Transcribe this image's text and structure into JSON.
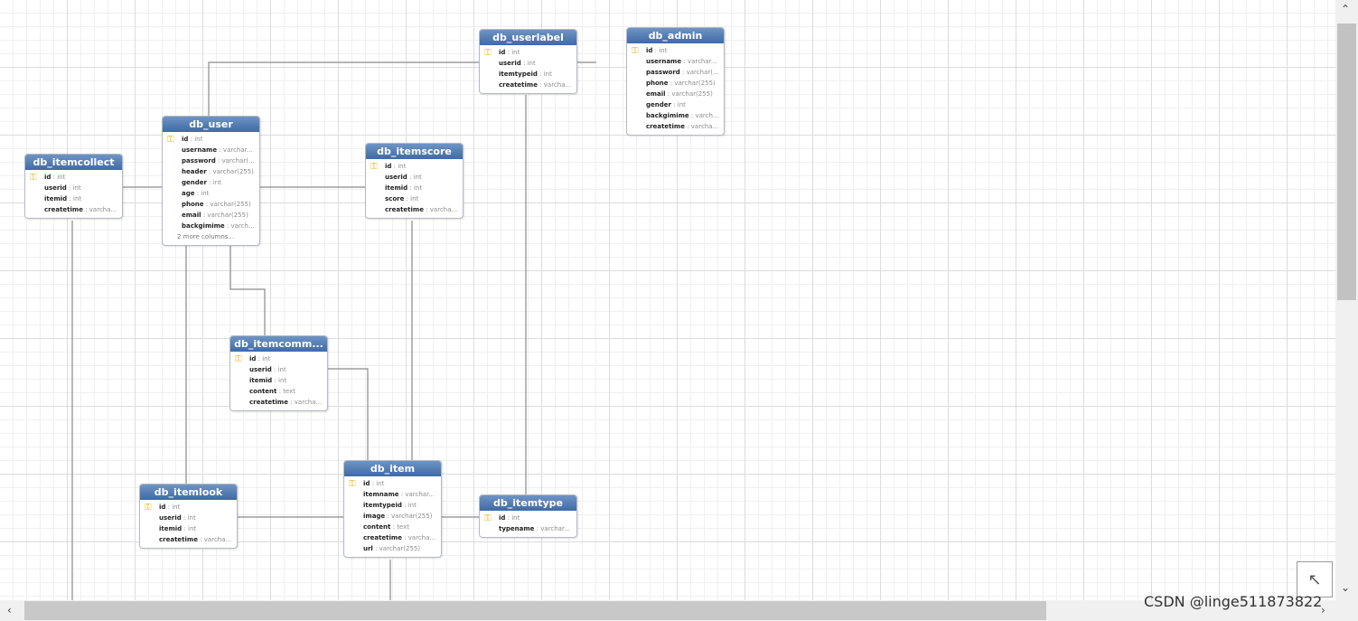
{
  "tables": [
    {
      "id": "db_userlabel",
      "title": "db_userlabel",
      "columns": [
        {
          "name": "id",
          "type": "int",
          "pk": true
        },
        {
          "name": "userid",
          "type": "int"
        },
        {
          "name": "itemtypeid",
          "type": "int"
        },
        {
          "name": "createtime",
          "type": "varcha..."
        }
      ]
    },
    {
      "id": "db_admin",
      "title": "db_admin",
      "columns": [
        {
          "name": "id",
          "type": "int",
          "pk": true
        },
        {
          "name": "username",
          "type": "varchar..."
        },
        {
          "name": "password",
          "type": "varchar(..."
        },
        {
          "name": "phone",
          "type": "varchar(255)"
        },
        {
          "name": "email",
          "type": "varchar(255)"
        },
        {
          "name": "gender",
          "type": "int"
        },
        {
          "name": "backgimime",
          "type": "varch..."
        },
        {
          "name": "createtime",
          "type": "varcha..."
        }
      ]
    },
    {
      "id": "db_user",
      "title": "db_user",
      "more": "2 more columns...",
      "columns": [
        {
          "name": "id",
          "type": "int",
          "pk": true
        },
        {
          "name": "username",
          "type": "varchar..."
        },
        {
          "name": "password",
          "type": "varchar(..."
        },
        {
          "name": "header",
          "type": "varchar(255)"
        },
        {
          "name": "gender",
          "type": "int"
        },
        {
          "name": "age",
          "type": "int"
        },
        {
          "name": "phone",
          "type": "varchar(255)"
        },
        {
          "name": "email",
          "type": "varchar(255)"
        },
        {
          "name": "backgimime",
          "type": "varch..."
        }
      ]
    },
    {
      "id": "db_itemcollect",
      "title": "db_itemcollect",
      "columns": [
        {
          "name": "id",
          "type": "int",
          "pk": true
        },
        {
          "name": "userid",
          "type": "int"
        },
        {
          "name": "itemid",
          "type": "int"
        },
        {
          "name": "createtime",
          "type": "varcha..."
        }
      ]
    },
    {
      "id": "db_itemscore",
      "title": "db_itemscore",
      "columns": [
        {
          "name": "id",
          "type": "int",
          "pk": true
        },
        {
          "name": "userid",
          "type": "int"
        },
        {
          "name": "itemid",
          "type": "int"
        },
        {
          "name": "score",
          "type": "int"
        },
        {
          "name": "createtime",
          "type": "varcha..."
        }
      ]
    },
    {
      "id": "db_itemcomment",
      "title": "db_itemcomm...",
      "columns": [
        {
          "name": "id",
          "type": "int",
          "pk": true
        },
        {
          "name": "userid",
          "type": "int"
        },
        {
          "name": "itemid",
          "type": "int"
        },
        {
          "name": "content",
          "type": "text"
        },
        {
          "name": "createtime",
          "type": "varcha..."
        }
      ]
    },
    {
      "id": "db_item",
      "title": "db_item",
      "columns": [
        {
          "name": "id",
          "type": "int",
          "pk": true
        },
        {
          "name": "itemname",
          "type": "varchar..."
        },
        {
          "name": "itemtypeid",
          "type": "int"
        },
        {
          "name": "image",
          "type": "varchar(255)"
        },
        {
          "name": "content",
          "type": "text"
        },
        {
          "name": "createtime",
          "type": "varcha..."
        },
        {
          "name": "url",
          "type": "varchar(255)"
        }
      ]
    },
    {
      "id": "db_itemlook",
      "title": "db_itemlook",
      "columns": [
        {
          "name": "id",
          "type": "int",
          "pk": true
        },
        {
          "name": "userid",
          "type": "int"
        },
        {
          "name": "itemid",
          "type": "int"
        },
        {
          "name": "createtime",
          "type": "varcha..."
        }
      ]
    },
    {
      "id": "db_itemtype",
      "title": "db_itemtype",
      "columns": [
        {
          "name": "id",
          "type": "int",
          "pk": true
        },
        {
          "name": "typename",
          "type": "varchar..."
        }
      ]
    }
  ],
  "icons": {
    "primary_key": "key-icon",
    "navigate": "navigate-up-left-icon"
  },
  "colors": {
    "header": "#4a76b0",
    "grid": "#dcdcdc",
    "link": "#8a8a8a"
  },
  "watermark": "CSDN @linge511873822"
}
